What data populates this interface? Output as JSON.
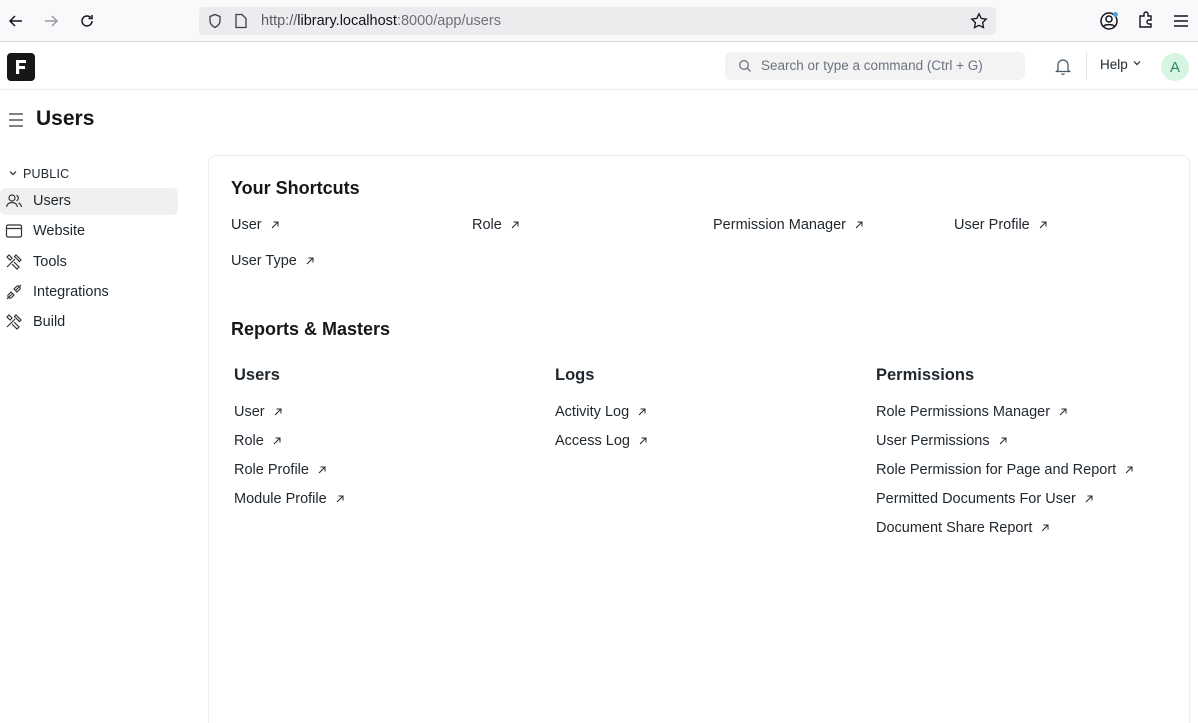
{
  "browser": {
    "url_scheme": "http://",
    "url_host": "library.localhost",
    "url_rest": ":8000/app/users"
  },
  "navbar": {
    "logo_letter": "F",
    "search_placeholder": "Search or type a command (Ctrl + G)",
    "help_label": "Help",
    "avatar_letter": "A"
  },
  "page": {
    "title": "Users"
  },
  "sidebar": {
    "section_label": "PUBLIC",
    "items": [
      {
        "label": "Users",
        "icon": "users-icon"
      },
      {
        "label": "Website",
        "icon": "website-icon"
      },
      {
        "label": "Tools",
        "icon": "tools-icon"
      },
      {
        "label": "Integrations",
        "icon": "integrations-icon"
      },
      {
        "label": "Build",
        "icon": "build-icon"
      }
    ]
  },
  "shortcuts": {
    "title": "Your Shortcuts",
    "items": [
      "User",
      "Role",
      "Permission Manager",
      "User Profile",
      "User Type"
    ]
  },
  "reports": {
    "title": "Reports & Masters",
    "columns": [
      {
        "title": "Users",
        "links": [
          "User",
          "Role",
          "Role Profile",
          "Module Profile"
        ]
      },
      {
        "title": "Logs",
        "links": [
          "Activity Log",
          "Access Log"
        ]
      },
      {
        "title": "Permissions",
        "links": [
          "Role Permissions Manager",
          "User Permissions",
          "Role Permission for Page and Report",
          "Permitted Documents For User",
          "Document Share Report"
        ]
      }
    ]
  }
}
